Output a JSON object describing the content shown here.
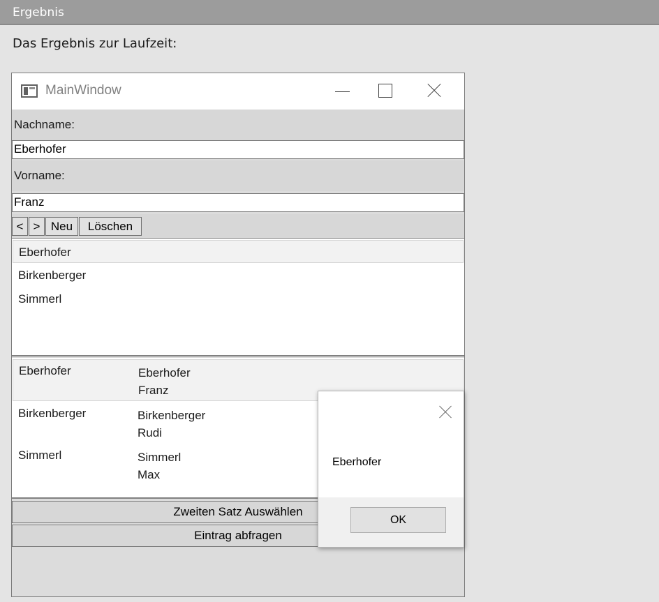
{
  "header": {
    "title": "Ergebnis"
  },
  "intro": "Das Ergebnis zur Laufzeit:",
  "window": {
    "title": "MainWindow",
    "icons": {
      "app": "app-window-icon",
      "minimize": "minimize-icon",
      "maximize": "maximize-icon",
      "close": "close-icon"
    },
    "nachname_label": "Nachname:",
    "nachname_value": "Eberhofer",
    "vorname_label": "Vorname:",
    "vorname_value": "Franz",
    "nav": {
      "prev": "<",
      "next": ">",
      "new": "Neu",
      "delete": "Löschen"
    },
    "listbox": [
      "Eberhofer",
      "Birkenberger",
      "Simmerl"
    ],
    "listview": [
      {
        "name": "Eberhofer",
        "nachname": "Eberhofer",
        "vorname": "Franz"
      },
      {
        "name": "Birkenberger",
        "nachname": "Birkenberger",
        "vorname": "Rudi"
      },
      {
        "name": "Simmerl",
        "nachname": "Simmerl",
        "vorname": "Max"
      }
    ],
    "btn_second": "Zweiten Satz Auswählen",
    "btn_query": "Eintrag abfragen"
  },
  "dialog": {
    "message": "Eberhofer",
    "ok": "OK"
  },
  "colors": {
    "header_bar": "#9c9c9c",
    "page_bg": "#e4e4e4",
    "window_bg": "#dcdcdc",
    "selection": "#f2f2f2"
  }
}
